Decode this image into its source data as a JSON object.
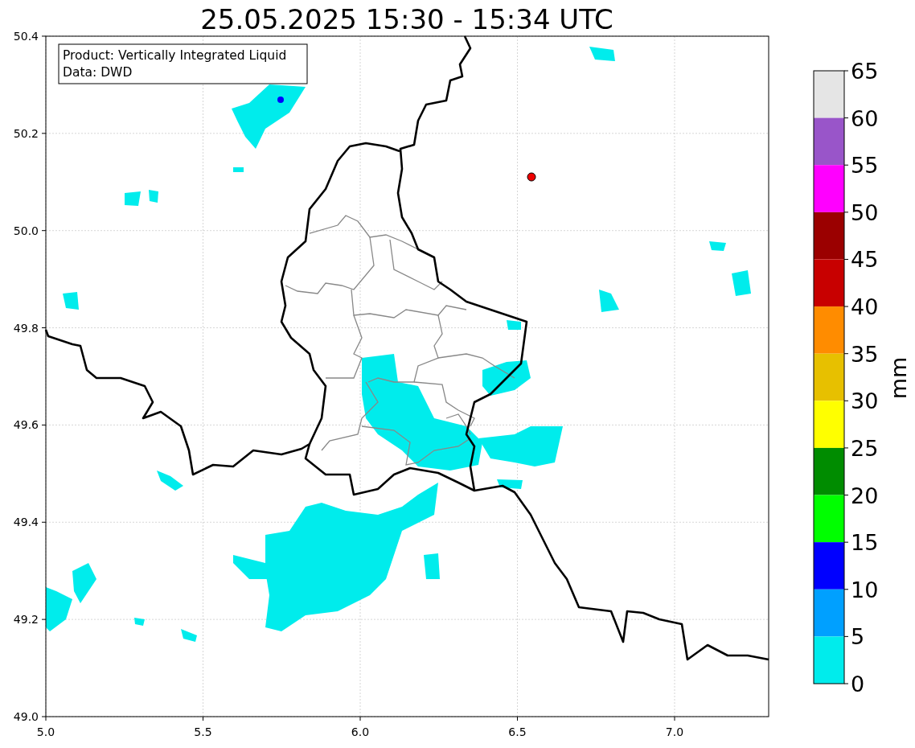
{
  "title": "25.05.2025 15:30 - 15:34 UTC",
  "info_box": [
    "Product: Vertically Integrated Liquid",
    "Data: DWD"
  ],
  "map": {
    "x_ticks": [
      "5.0",
      "5.5",
      "6.0",
      "6.5",
      "7.0"
    ],
    "y_ticks": [
      "50.4",
      "50.2",
      "50.0",
      "49.8",
      "49.6",
      "49.4",
      "49.2",
      "49.0"
    ]
  },
  "colorbar": {
    "label": "mm",
    "bins": [
      {
        "color": "#e5e5e5"
      },
      {
        "color": "#9955c9"
      },
      {
        "color": "#ff00ff"
      },
      {
        "color": "#9b0000"
      },
      {
        "color": "#c80000"
      },
      {
        "color": "#ff8c00"
      },
      {
        "color": "#e7c000"
      },
      {
        "color": "#ffff00"
      },
      {
        "color": "#008c00"
      },
      {
        "color": "#00ff00"
      },
      {
        "color": "#0000ff"
      },
      {
        "color": "#00a0ff"
      },
      {
        "color": "#00ecec"
      }
    ],
    "ticks": [
      "65",
      "60",
      "55",
      "50",
      "45",
      "40",
      "35",
      "30",
      "25",
      "20",
      "15",
      "10",
      "5",
      "0"
    ]
  }
}
